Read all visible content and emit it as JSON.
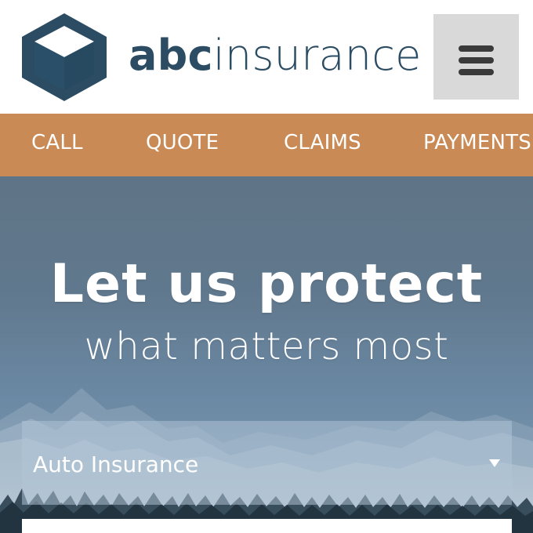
{
  "header": {
    "brand_bold": "abc",
    "brand_light": "insurance"
  },
  "nav": {
    "items": [
      {
        "label": "CALL"
      },
      {
        "label": "QUOTE"
      },
      {
        "label": "CLAIMS"
      },
      {
        "label": "PAYMENTS"
      }
    ]
  },
  "hero": {
    "title": "Let us protect",
    "subtitle": "what matters most",
    "insurance_select": {
      "selected": "Auto Insurance"
    }
  },
  "colors": {
    "brand_blue": "#2b4c63",
    "nav_orange": "#c98a55",
    "menu_gray": "#d9d9d9",
    "hero_blue": "#5d7386"
  },
  "icons": {
    "logo": "cube-logo-icon",
    "menu": "hamburger-menu-icon",
    "dropdown": "caret-down-icon"
  }
}
